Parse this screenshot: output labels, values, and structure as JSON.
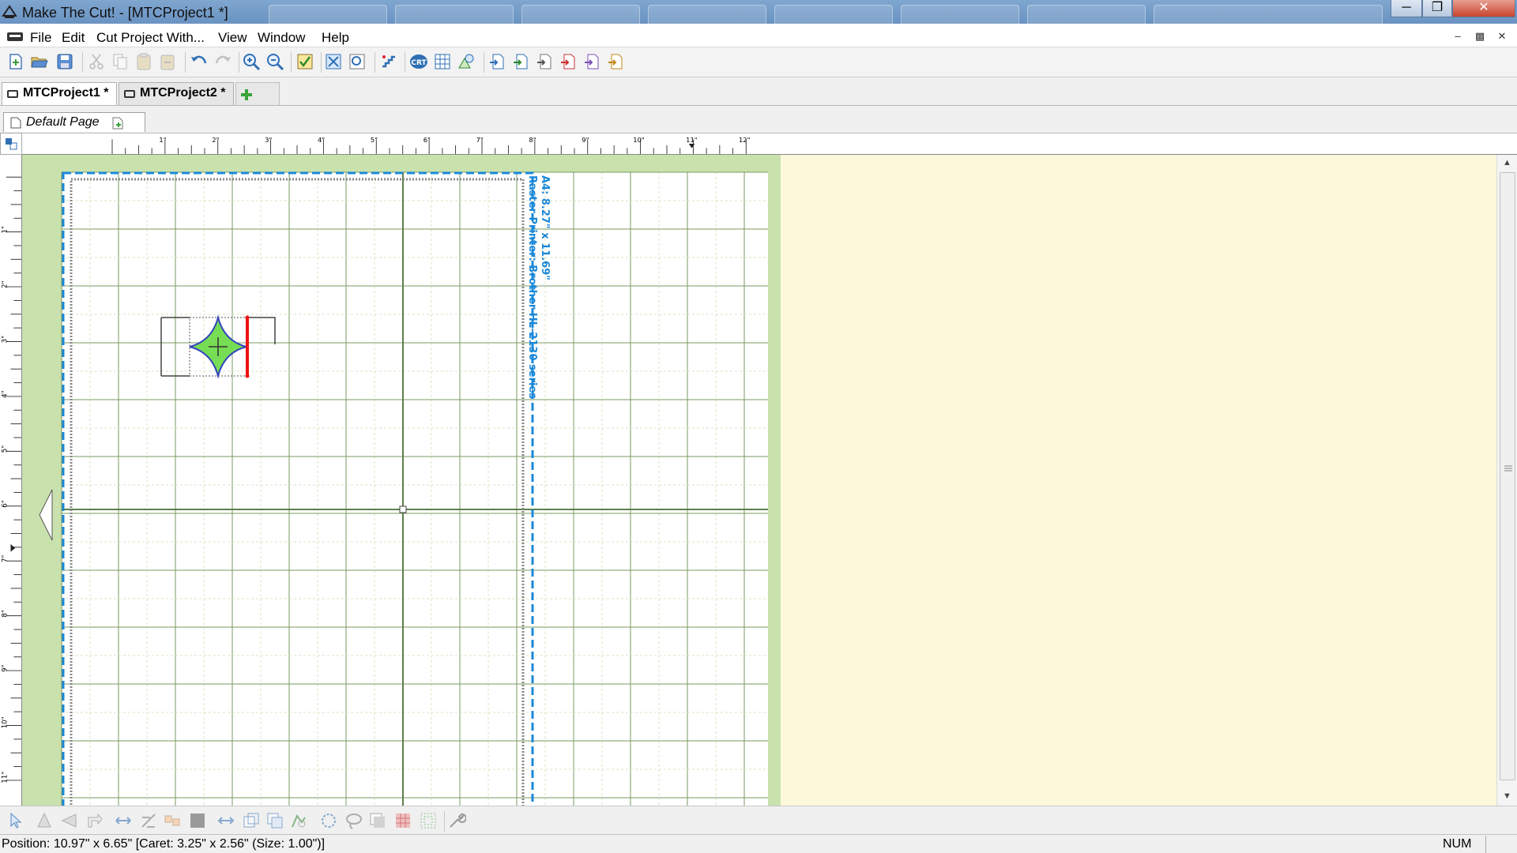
{
  "window": {
    "title": "Make The Cut! - [MTCProject1 *]",
    "icons": [
      "minimize-icon",
      "restore-icon",
      "close-icon"
    ]
  },
  "menubar": {
    "items": [
      "File",
      "Edit",
      "Cut Project With...",
      "View",
      "Window",
      "Help"
    ]
  },
  "toolbar": {
    "icons": [
      "new-icon",
      "open-icon",
      "save-icon",
      "cut-icon",
      "copy-icon",
      "paste-icon",
      "paste-in-place-icon",
      "undo-icon",
      "redo-icon",
      "zoom-in-icon",
      "zoom-out-icon",
      "select-check-icon",
      "fit-page-icon",
      "zoom-selection-icon",
      "snap-grid-icon",
      "crt-icon",
      "grid-icon",
      "shapes-icon",
      "import-1-icon",
      "import-2-icon",
      "import-3-icon",
      "import-4-icon",
      "import-5-icon",
      "import-6-icon"
    ]
  },
  "project_tabs": [
    {
      "label": "MTCProject1 *",
      "active": true
    },
    {
      "label": "MTCProject2 *",
      "active": false
    }
  ],
  "page_tab": {
    "label": "Default Page"
  },
  "rulers": {
    "h_labels": [
      "1\"",
      "2\"",
      "3\"",
      "4\"",
      "5\"",
      "6\"",
      "7\"",
      "8\"",
      "9\"",
      "10\"",
      "11\"",
      "12\""
    ],
    "v_labels": [
      "1\"",
      "2\"",
      "3\"",
      "4\"",
      "5\"",
      "6\"",
      "7\"",
      "8\"",
      "9\"",
      "10\"",
      "11\""
    ]
  },
  "page_label": {
    "line1": "A4: 8.27\" x 11.69\"",
    "line2": "Raster Printer: Brother HL-2130 series"
  },
  "colors": {
    "mat_green": "#c9e2ad",
    "workspace_bg": "#fef8da",
    "page_border": "#1a88d8",
    "shape_fill": "#77dd55",
    "selection_handle": "#ee1111"
  },
  "bottom_toolbar": {
    "icons": [
      "pointer-icon",
      "flip-vertical-icon",
      "flip-horizontal-icon",
      "rotate-icon",
      "align-icon",
      "distribute-icon",
      "group-icon",
      "fill-icon",
      "weld-icon",
      "layer-icon",
      "layer-2-icon",
      "shape-icon",
      "node-icon",
      "lasso-icon",
      "shadow-icon",
      "pattern-icon",
      "texture-icon",
      "wrench-icon"
    ]
  },
  "statusbar": {
    "text": "Position: 10.97\" x 6.65\" [Caret: 3.25\" x 2.56\" (Size: 1.00\")]",
    "num": "NUM"
  }
}
